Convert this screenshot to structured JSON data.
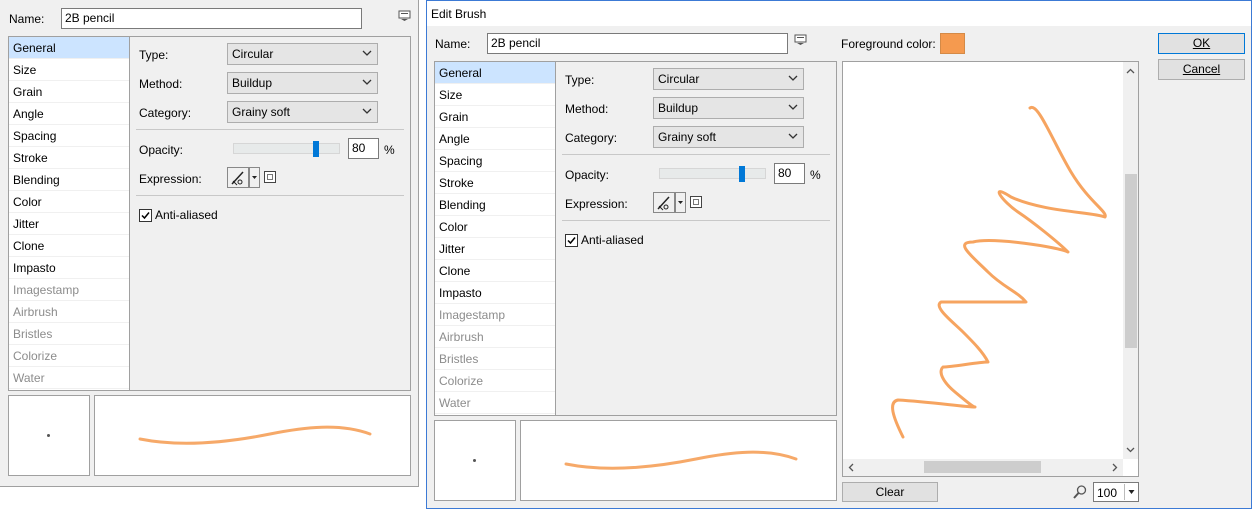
{
  "colors": {
    "accent": "#0078d7",
    "selection": "#cce4ff",
    "foreground_swatch": "#f59a4f",
    "stroke": "#f59a4f"
  },
  "left_panel": {
    "name_label": "Name:",
    "name_value": "2B pencil",
    "categories": [
      {
        "label": "General",
        "selected": true,
        "enabled": true
      },
      {
        "label": "Size",
        "enabled": true
      },
      {
        "label": "Grain",
        "enabled": true
      },
      {
        "label": "Angle",
        "enabled": true
      },
      {
        "label": "Spacing",
        "enabled": true
      },
      {
        "label": "Stroke",
        "enabled": true
      },
      {
        "label": "Blending",
        "enabled": true
      },
      {
        "label": "Color",
        "enabled": true
      },
      {
        "label": "Jitter",
        "enabled": true
      },
      {
        "label": "Clone",
        "enabled": true
      },
      {
        "label": "Impasto",
        "enabled": true
      },
      {
        "label": "Imagestamp",
        "enabled": false
      },
      {
        "label": "Airbrush",
        "enabled": false
      },
      {
        "label": "Bristles",
        "enabled": false
      },
      {
        "label": "Colorize",
        "enabled": false
      },
      {
        "label": "Water",
        "enabled": false
      }
    ],
    "type_label": "Type:",
    "type_value": "Circular",
    "method_label": "Method:",
    "method_value": "Buildup",
    "category_label": "Category:",
    "category_value": "Grainy soft",
    "opacity_label": "Opacity:",
    "opacity_value": "80",
    "opacity_fraction": 0.8,
    "opacity_unit": "%",
    "expression_label": "Expression:",
    "antialiased_label": "Anti-aliased",
    "antialiased_checked": true
  },
  "dialog": {
    "title": "Edit Brush",
    "name_label": "Name:",
    "name_value": "2B pencil",
    "foreground_label": "Foreground color:",
    "ok_label": "OK",
    "cancel_label": "Cancel",
    "clear_label": "Clear",
    "zoom_value": "100",
    "categories": [
      {
        "label": "General",
        "selected": true,
        "enabled": true
      },
      {
        "label": "Size",
        "enabled": true
      },
      {
        "label": "Grain",
        "enabled": true
      },
      {
        "label": "Angle",
        "enabled": true
      },
      {
        "label": "Spacing",
        "enabled": true
      },
      {
        "label": "Stroke",
        "enabled": true
      },
      {
        "label": "Blending",
        "enabled": true
      },
      {
        "label": "Color",
        "enabled": true
      },
      {
        "label": "Jitter",
        "enabled": true
      },
      {
        "label": "Clone",
        "enabled": true
      },
      {
        "label": "Impasto",
        "enabled": true
      },
      {
        "label": "Imagestamp",
        "enabled": false
      },
      {
        "label": "Airbrush",
        "enabled": false
      },
      {
        "label": "Bristles",
        "enabled": false
      },
      {
        "label": "Colorize",
        "enabled": false
      },
      {
        "label": "Water",
        "enabled": false
      }
    ],
    "type_label": "Type:",
    "type_value": "Circular",
    "method_label": "Method:",
    "method_value": "Buildup",
    "category_label": "Category:",
    "category_value": "Grainy soft",
    "opacity_label": "Opacity:",
    "opacity_value": "80",
    "opacity_fraction": 0.8,
    "opacity_unit": "%",
    "expression_label": "Expression:",
    "antialiased_label": "Anti-aliased",
    "antialiased_checked": true
  }
}
